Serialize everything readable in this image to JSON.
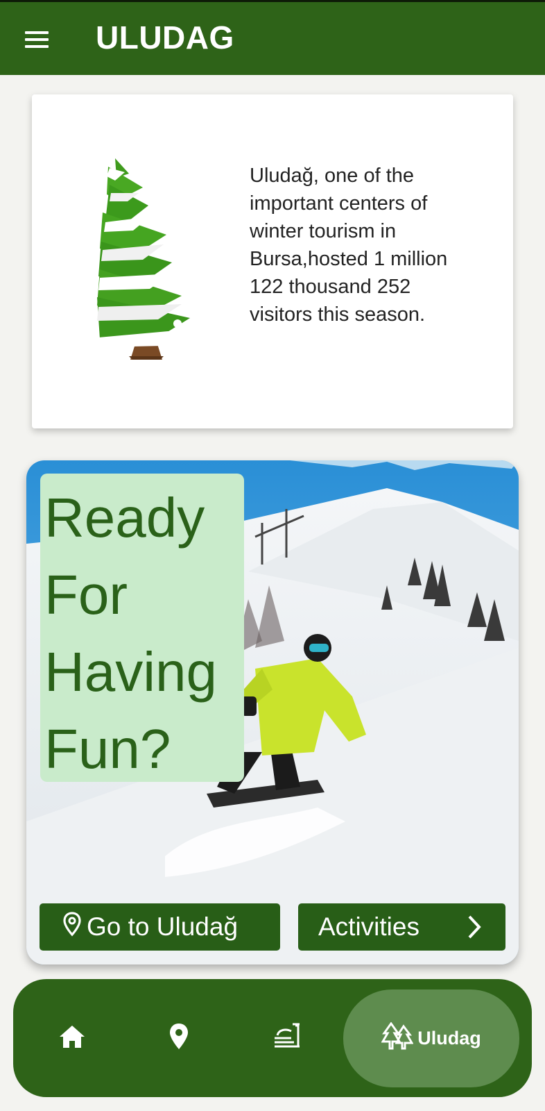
{
  "appbar": {
    "title": "ULUDAG"
  },
  "info_card": {
    "text": "Uludağ, one of the important centers of winter tourism in Bursa,hosted 1 million 122 thousand 252 visitors this season."
  },
  "hero": {
    "title": "Ready For Having Fun?",
    "go_button_label": "Go to Uludağ",
    "activities_button_label": "Activities"
  },
  "bottom_nav": {
    "items": [
      {
        "icon": "home-icon"
      },
      {
        "icon": "location-pin-icon"
      },
      {
        "icon": "activities-icon"
      },
      {
        "icon": "pine-trees-icon",
        "label": "Uludag",
        "active": true
      }
    ]
  },
  "colors": {
    "primary_green": "#2e6318",
    "badge_bg": "#c9ebcb",
    "active_tab": "#5e8c4e"
  }
}
